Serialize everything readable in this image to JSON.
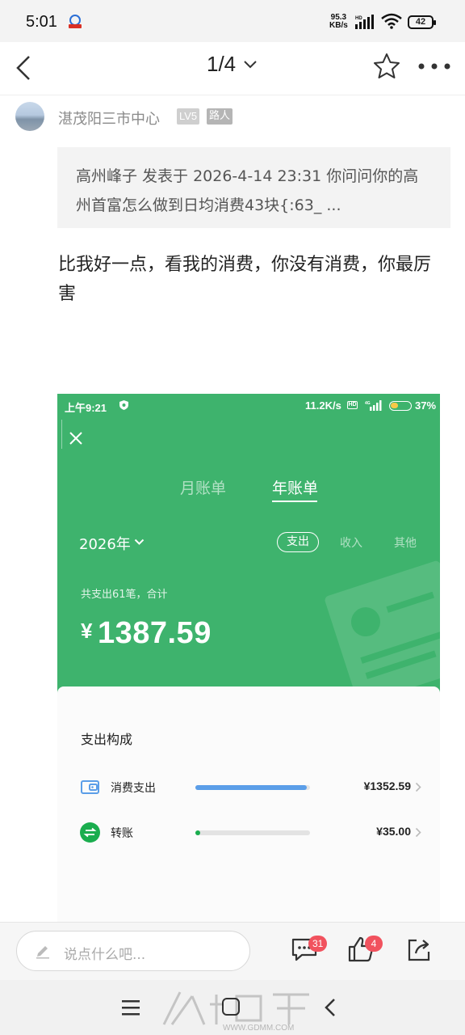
{
  "status_bar": {
    "time": "5:01",
    "net_speed_value": "95.3",
    "net_speed_unit": "KB/s",
    "battery": "42"
  },
  "header": {
    "page_indicator": "1/4"
  },
  "author": {
    "name": "湛茂阳三市中心",
    "level": "LV5",
    "role": "路人"
  },
  "quote": {
    "text": "高州峰子 发表于 2026-4-14 23:31 你问问你的高州首富怎么做到日均消费43块{:63_ ..."
  },
  "post": {
    "text": "比我好一点，看我的消费，你没有消费，你最厉害"
  },
  "embedded": {
    "status_time": "上午9:21",
    "status_speed": "11.2K/s",
    "status_hd": "HD",
    "status_battery": "37%",
    "tabs": [
      {
        "label": "月账单",
        "active": false
      },
      {
        "label": "年账单",
        "active": true
      }
    ],
    "year": "2026年",
    "filter_active": "支出",
    "filter_income": "收入",
    "filter_other": "其他",
    "summary": "共支出61笔，合计",
    "currency": "¥",
    "total": "1387.59",
    "breakdown_title": "支出构成",
    "categories": [
      {
        "label": "消费支出",
        "value": "¥1352.59",
        "share": 0.975,
        "color": "#5b9ee8"
      },
      {
        "label": "转账",
        "value": "¥35.00",
        "share": 0.025,
        "color": "#1aad4e"
      }
    ]
  },
  "action_bar": {
    "comment_placeholder": "说点什么吧...",
    "comment_count": "31",
    "like_count": "4"
  },
  "watermark": {
    "url": "WWW.GDMM.COM"
  }
}
